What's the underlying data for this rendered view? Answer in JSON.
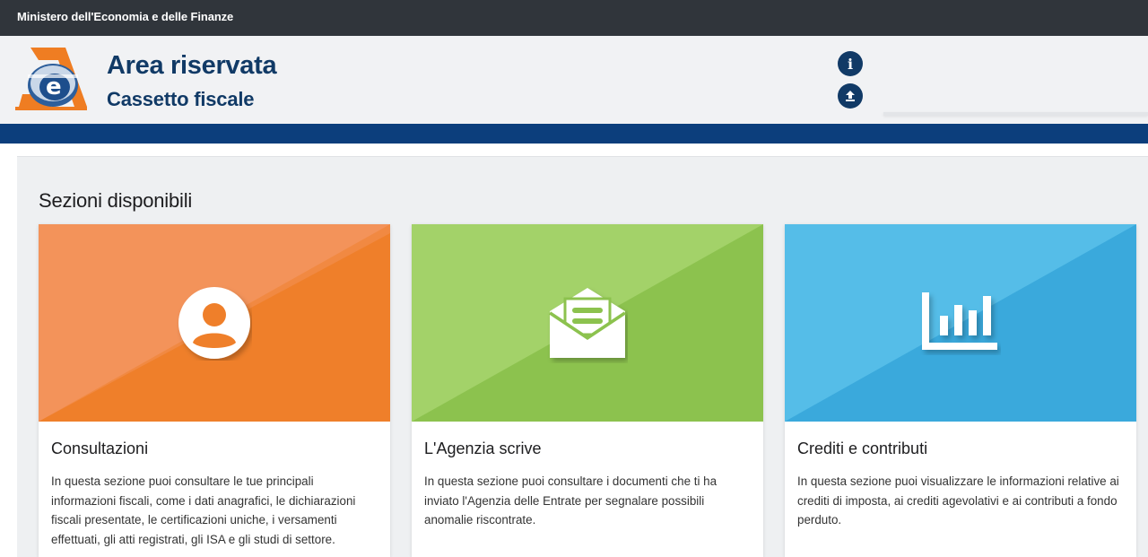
{
  "topbar": {
    "ministry": "Ministero dell'Economia e delle Finanze"
  },
  "header": {
    "title": "Area riservata",
    "subtitle": "Cassetto fiscale",
    "icons": [
      "info-icon",
      "upload-icon"
    ],
    "brand_color": "#113a66",
    "stripe_color": "#0c3e7c"
  },
  "main": {
    "section_title": "Sezioni disponibili",
    "cards": [
      {
        "title": "Consultazioni",
        "description": "In questa sezione puoi consultare le tue principali informazioni fiscali, come i dati anagrafici, le dichiarazioni fiscali presentate, le certificazioni uniche, i versamenti effettuati, gli atti registrati, gli ISA e gli studi di settore.",
        "icon": "user-icon",
        "color": "#f07f2f"
      },
      {
        "title": "L'Agenzia scrive",
        "description": "In questa sezione puoi consultare i documenti che ti ha inviato l'Agenzia delle Entrate per segnalare possibili anomalie riscontrate.",
        "icon": "open-envelope-icon",
        "color": "#8bc34a"
      },
      {
        "title": "Crediti e contributi",
        "description": "In questa sezione puoi visualizzare le informazioni relative ai crediti di imposta, ai crediti agevolativi e ai contributi a fondo perduto.",
        "icon": "bar-chart-icon",
        "color": "#3aaadc"
      }
    ]
  }
}
